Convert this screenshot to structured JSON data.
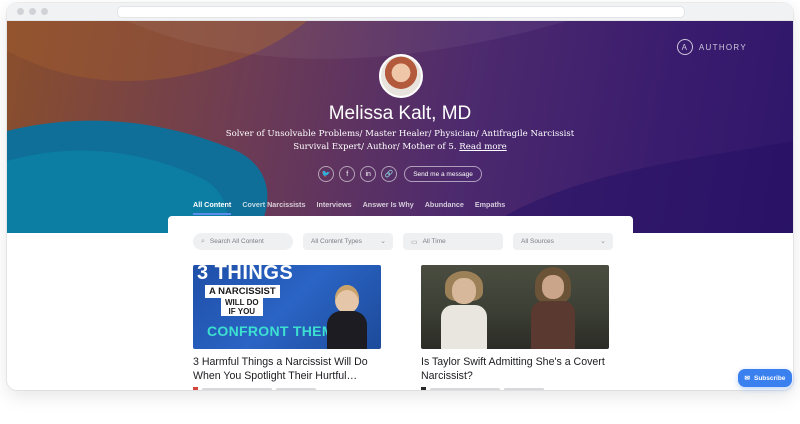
{
  "brand": {
    "name": "AUTHORY",
    "icon": "authory-logo-icon"
  },
  "profile": {
    "name": "Melissa Kalt, MD",
    "bio_line1": "Solver of Unsolvable Problems/ Master Healer/ Physician/ Antifragile Narcissist",
    "bio_line2": "Survival Expert/ Author/ Mother of 5.",
    "read_more": "Read more"
  },
  "socials": {
    "twitter": "🐦",
    "facebook": "f",
    "linkedin": "in",
    "link": "🔗",
    "message_button": "Send me a message"
  },
  "tabs": [
    {
      "label": "All Content",
      "active": true
    },
    {
      "label": "Covert Narcissists",
      "active": false
    },
    {
      "label": "Interviews",
      "active": false
    },
    {
      "label": "Answer Is Why",
      "active": false
    },
    {
      "label": "Abundance",
      "active": false
    },
    {
      "label": "Empaths",
      "active": false
    }
  ],
  "filters": {
    "search_placeholder": "Search All Content",
    "content_types": "All Content Types",
    "time": "All Time",
    "sources": "All Sources"
  },
  "cards": [
    {
      "title": "3 Harmful Things a Narcissist Will Do When You Spotlight Their Hurtful…",
      "thumb_text_1": "3 THINGS",
      "thumb_text_2": "A NARCISSIST",
      "thumb_text_3": "WILL DO\nIF YOU",
      "thumb_text_4": "CONFRONT THEM"
    },
    {
      "title": "Is Taylor Swift Admitting She's a Covert Narcissist?"
    }
  ],
  "subscribe": {
    "label": "Subscribe"
  },
  "colors": {
    "accent": "#3b80ef",
    "hero_start": "#8a4f2c",
    "hero_end": "#2f166a"
  }
}
